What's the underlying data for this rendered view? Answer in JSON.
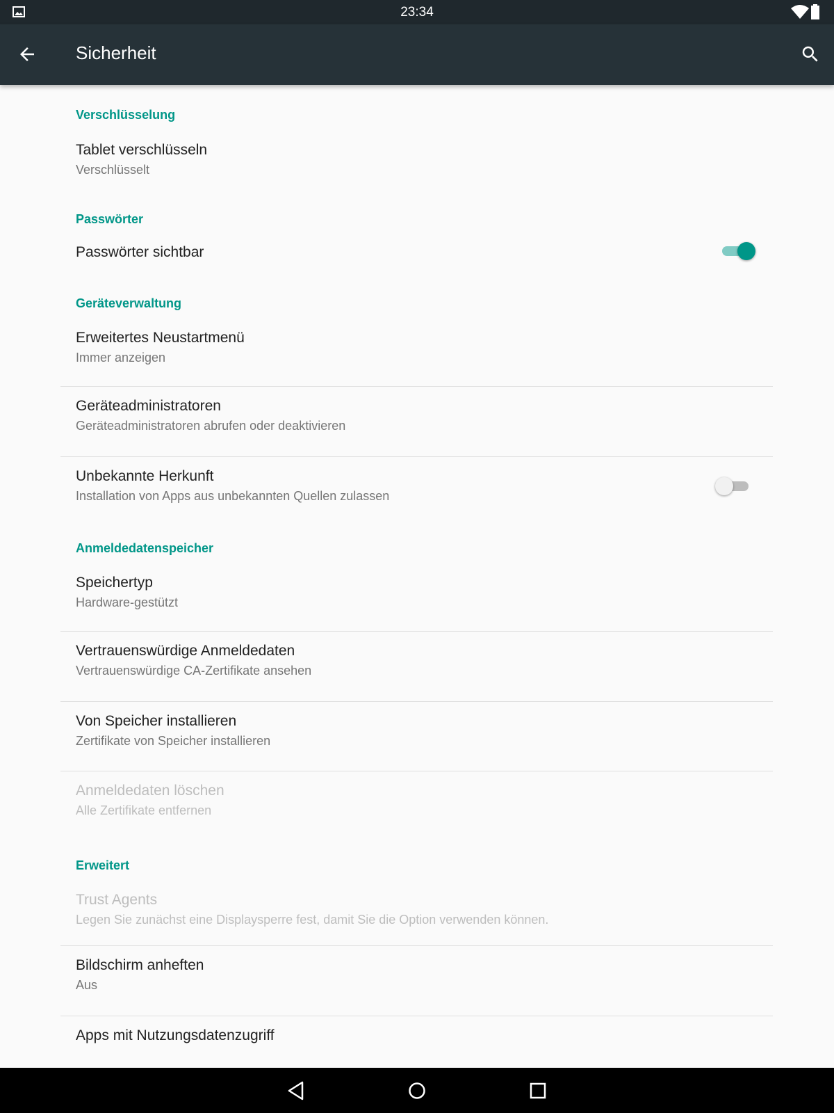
{
  "status_bar": {
    "time": "23:34",
    "icons": [
      "gallery-icon",
      "wifi-icon",
      "battery-icon"
    ]
  },
  "app_bar": {
    "title": "Sicherheit",
    "back_icon": "arrow-back-icon",
    "search_icon": "search-icon"
  },
  "sections": {
    "encryption": {
      "header": "Verschlüsselung",
      "encrypt_tablet": {
        "title": "Tablet verschlüsseln",
        "summary": "Verschlüsselt"
      }
    },
    "passwords": {
      "header": "Passwörter",
      "show_passwords": {
        "title": "Passwörter sichtbar",
        "checked": true
      }
    },
    "device_admin": {
      "header": "Geräteverwaltung",
      "advanced_reboot": {
        "title": "Erweitertes Neustartmenü",
        "summary": "Immer anzeigen"
      },
      "device_administrators": {
        "title": "Geräteadministratoren",
        "summary": "Geräteadministratoren abrufen oder deaktivieren"
      },
      "unknown_sources": {
        "title": "Unbekannte Herkunft",
        "summary": "Installation von Apps aus unbekannten Quellen zulassen",
        "checked": false
      }
    },
    "credential_storage": {
      "header": "Anmeldedatenspeicher",
      "storage_type": {
        "title": "Speichertyp",
        "summary": "Hardware-gestützt"
      },
      "trusted_credentials": {
        "title": "Vertrauenswürdige Anmeldedaten",
        "summary": "Vertrauenswürdige CA-Zertifikate ansehen"
      },
      "install_from_storage": {
        "title": "Von Speicher installieren",
        "summary": "Zertifikate von Speicher installieren"
      },
      "clear_credentials": {
        "title": "Anmeldedaten löschen",
        "summary": "Alle Zertifikate entfernen",
        "enabled": false
      }
    },
    "advanced": {
      "header": "Erweitert",
      "trust_agents": {
        "title": "Trust Agents",
        "summary": "Legen Sie zunächst eine Displaysperre fest, damit Sie die Option verwenden können.",
        "enabled": false
      },
      "screen_pinning": {
        "title": "Bildschirm anheften",
        "summary": "Aus"
      },
      "usage_access": {
        "title": "Apps mit Nutzungsdatenzugriff"
      }
    }
  },
  "colors": {
    "accent": "#009688",
    "app_bar": "#263238",
    "status_bar": "#1f282d",
    "background": "#fafafa",
    "primary_text": "#212121",
    "secondary_text": "#757575",
    "disabled_text": "#bdbdbd"
  },
  "nav_bar": {
    "icons": [
      "back-triangle-icon",
      "home-circle-icon",
      "recents-square-icon"
    ]
  }
}
